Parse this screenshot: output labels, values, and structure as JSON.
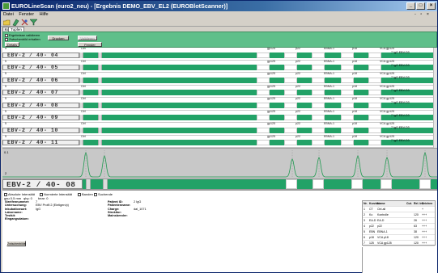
{
  "window": {
    "title": "EUROLineScan (euro2_neu) - [Ergebnis DEMO_EBV_EL2 (EUROBlotScanner)]",
    "controls": [
      "_",
      "□",
      "×"
    ]
  },
  "menu": {
    "items": [
      "Datei",
      "Fenster",
      "Hilfe"
    ],
    "mdi": "- ▫ ×"
  },
  "tabs": [
    "Ko",
    "Tupfen"
  ],
  "panel": {
    "chk1": "Ergebnisse validieren",
    "chk2": "Zwischenbild erhalten",
    "btn_drucken": "Drucken",
    "btn_disabled": "Validieren",
    "btn_details": "Details",
    "btn_fenster": "Fenster schließen"
  },
  "strip_header": {
    "ctrl": "Ctrl",
    "b1": "gp125",
    "b2": "p22",
    "b3": "EBNA-1",
    "b4": "p18",
    "b5": "VCA gp125",
    "units": "5"
  },
  "strips": [
    {
      "label": "EBV-2 / 40- 04",
      "result": "7 IgG EBV-D3"
    },
    {
      "label": "EBV-2 / 40- 05",
      "result": "7 IgG EBV-D3"
    },
    {
      "label": "EBV-2 / 40- 06",
      "result": "7 IgG EBV-D3"
    },
    {
      "label": "EBV-2 / 40- 07",
      "result": "7 IgG EBV-D3"
    },
    {
      "label": "EBV-2 / 40- 08",
      "result": "7 IgG EBV-D3"
    },
    {
      "label": "EBV-2 / 40- 09",
      "result": "7 IgG EBV-D3"
    },
    {
      "label": "EBV-2 / 40- 10",
      "result": "7 IgG EBV-D3"
    },
    {
      "label": "EBV-2 / 40- 11",
      "result": "7 IgG EBV-D3"
    }
  ],
  "plot": {
    "left_label": "0.1",
    "marker": "2"
  },
  "selected_strip": {
    "label": "EBV-2 / 40- 08"
  },
  "options": {
    "o1": "Absolute Intensität",
    "o2": "Normierte Intensität",
    "o3": "Banden",
    "o4": "Suchende",
    "field1_label": "gau 0.5 mm",
    "field1_value": "qby: 0",
    "field2_label": "bear: 0"
  },
  "info_left": [
    {
      "k": "Streifennummer:",
      "v": "7"
    },
    {
      "k": "Untersuchung:",
      "v": "EBV Profil 2 (Eintigen/p)"
    },
    {
      "k": "Inkubationsart:",
      "v": "IgG"
    },
    {
      "k": "Laborname:",
      "v": ""
    },
    {
      "k": "Testkit:",
      "v": ""
    },
    {
      "k": "Eingangsdatum:",
      "v": ""
    }
  ],
  "info_right": [
    {
      "k": "Patient ID:",
      "v": "2 IgG"
    },
    {
      "k": "Patientenname:",
      "v": ""
    },
    {
      "k": "Charge:",
      "v": "dal_1071"
    },
    {
      "k": "Strokitor:",
      "v": ""
    },
    {
      "k": "Mainsbender:",
      "v": ""
    }
  ],
  "results_button": "Zwischenbilde",
  "table": {
    "header": [
      "Nr.",
      "Kurzbz.",
      "Name",
      "Cut.",
      "Rel. Int.",
      "Zeichen"
    ],
    "rows": [
      [
        "1",
        "CT",
        "Ctrl-all",
        "",
        "",
        "+"
      ],
      [
        "2",
        "Ko",
        "Kontrolle",
        "",
        "120",
        "+++"
      ],
      [
        "3",
        "EA-D",
        "EA-D",
        "",
        "26",
        "+++"
      ],
      [
        "4",
        "p22",
        "p22",
        "",
        "63",
        "+++"
      ],
      [
        "5",
        "EBN",
        "EBNA-1",
        "",
        "38",
        "+++"
      ],
      [
        "6",
        "p18",
        "VCA p18",
        "",
        "120",
        "+++"
      ],
      [
        "7",
        "125",
        "VCA gp125",
        "",
        "120",
        "+++"
      ]
    ]
  },
  "colors": {
    "strip_green": "#22a267",
    "panel_green": "#5fbf8a",
    "title_start": "#0a246a"
  }
}
